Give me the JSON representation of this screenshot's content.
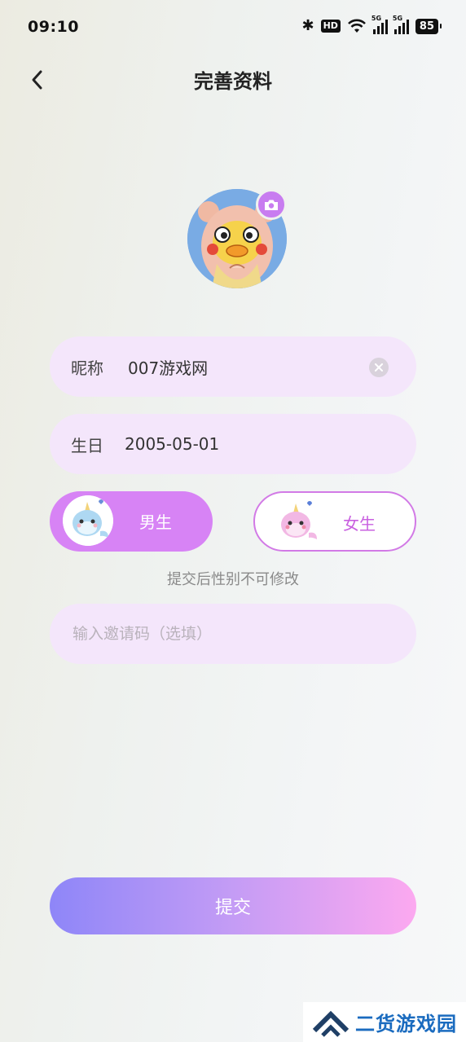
{
  "status_bar": {
    "time": "09:10",
    "hd_label": "HD",
    "signal_1_label": "5G",
    "signal_2_label": "5G",
    "battery": "85",
    "icons": [
      "bluetooth-icon",
      "hd-icon",
      "wifi-icon",
      "signal-icon",
      "signal-icon",
      "battery-icon"
    ]
  },
  "header": {
    "title": "完善资料",
    "back_icon": "chevron-left-icon"
  },
  "avatar": {
    "camera_icon": "camera-icon"
  },
  "form": {
    "nickname": {
      "label": "昵称",
      "value": "007游戏网",
      "clear_icon": "clear-icon"
    },
    "birthday": {
      "label": "生日",
      "value": "2005-05-01"
    },
    "gender": {
      "male_label": "男生",
      "female_label": "女生",
      "selected": "male",
      "note": "提交后性别不可修改"
    },
    "invite_code": {
      "placeholder": "输入邀请码（选填）",
      "value": ""
    }
  },
  "submit_label": "提交",
  "watermark": {
    "text": "二货游戏园"
  },
  "colors": {
    "accent": "#d783f5",
    "field_bg": "#f4e6fb",
    "submit_start": "#8e86f8",
    "submit_end": "#fca9f0"
  }
}
